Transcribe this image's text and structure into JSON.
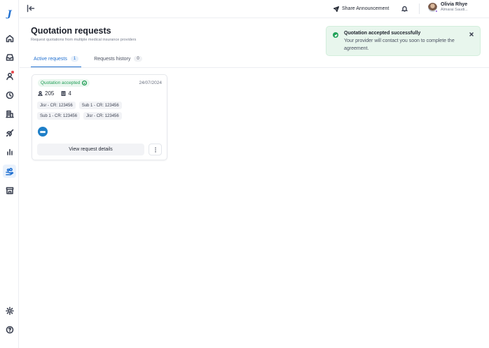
{
  "brand": {
    "logo_letter": "J"
  },
  "sidebar": {
    "items": [
      {
        "name": "home",
        "icon": "home-icon"
      },
      {
        "name": "inbox",
        "icon": "inbox-icon"
      },
      {
        "name": "users",
        "icon": "user-icon",
        "notification": true
      },
      {
        "name": "history",
        "icon": "clock-icon"
      },
      {
        "name": "documents",
        "icon": "building-icon"
      },
      {
        "name": "launch",
        "icon": "rocket-icon"
      },
      {
        "name": "analytics",
        "icon": "bar-chart-icon"
      },
      {
        "name": "quotations",
        "icon": "hand-coins-icon",
        "active": true
      },
      {
        "name": "organization",
        "icon": "store-icon"
      }
    ],
    "bottom": [
      {
        "name": "settings",
        "icon": "gear-icon"
      },
      {
        "name": "help",
        "icon": "help-circle-icon"
      }
    ]
  },
  "topbar": {
    "share_label": "Share Announcement",
    "user": {
      "name": "Olivia Rhye",
      "org": "Almarai Saudi..."
    }
  },
  "page": {
    "title": "Quotation requests",
    "subtitle": "Request quotations from multiple medical insurance providers"
  },
  "tabs": [
    {
      "label": "Active requests",
      "count": "1",
      "active": true
    },
    {
      "label": "Requests history",
      "count": "0",
      "active": false
    }
  ],
  "request_card": {
    "status": "Quotation accepted",
    "date": "24/07/2024",
    "members": "205",
    "branches": "4",
    "chips": [
      "Jisr - CR: 123456",
      "Sub 1 - CR: 123456",
      "Sub 1 - CR: 123456",
      "Jisr - CR: 123456"
    ],
    "view_label": "View request details"
  },
  "toast": {
    "title": "Quotation accepted successfully",
    "body": "Your provider will contact you soon to complete the agreement."
  },
  "colors": {
    "accent": "#1f6fd0",
    "success": "#1f9d55",
    "toast_bg": "#e8f6ed",
    "notification": "#e5484d"
  }
}
